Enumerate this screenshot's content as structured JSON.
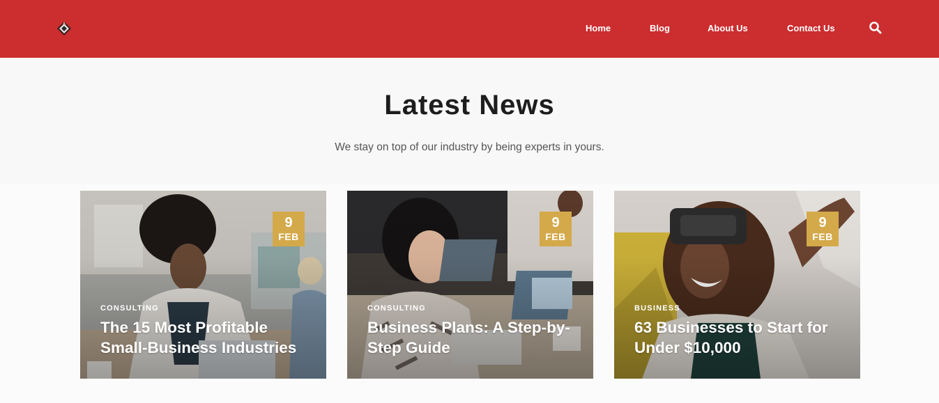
{
  "header": {
    "logo_icon": "diamond-logo-icon",
    "nav": [
      {
        "label": "Home"
      },
      {
        "label": "Blog"
      },
      {
        "label": "About Us"
      },
      {
        "label": "Contact Us"
      }
    ],
    "search_icon": "search-icon",
    "brand_color": "#cc2d2f"
  },
  "section": {
    "title": "Latest News",
    "subtitle": "We stay on top of our industry by being experts in yours."
  },
  "cards": [
    {
      "category": "CONSULTING",
      "title": "The 15 Most Profitable Small-Business Industries",
      "day": "9",
      "month": "FEB"
    },
    {
      "category": "CONSULTING",
      "title": "Business Plans: A Step-by-Step Guide",
      "day": "9",
      "month": "FEB"
    },
    {
      "category": "BUSINESS",
      "title": "63 Businesses to Start for Under $10,000",
      "day": "9",
      "month": "FEB"
    }
  ],
  "colors": {
    "badge": "#d4a94a",
    "title_text": "#1d1d1d"
  }
}
